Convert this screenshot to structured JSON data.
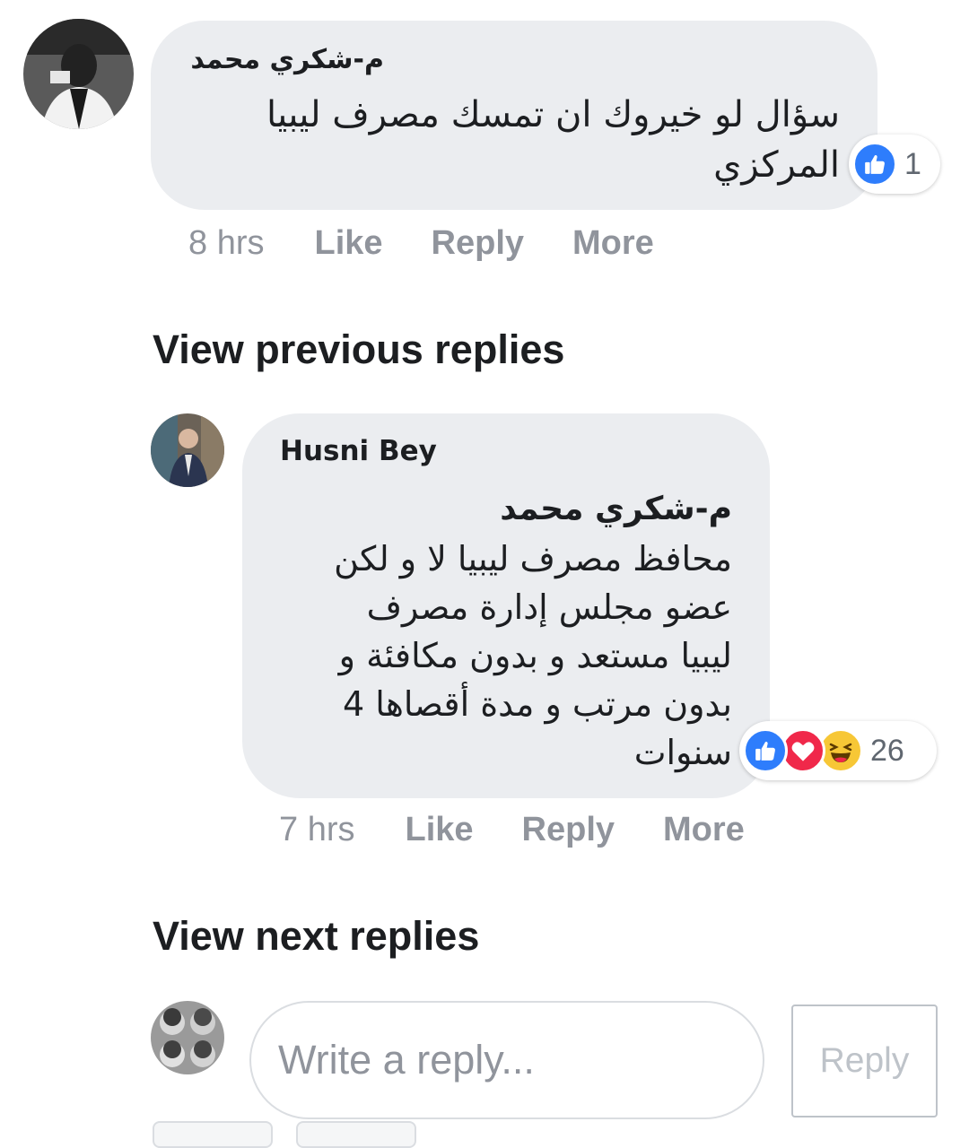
{
  "comment": {
    "author": "م-شكري محمد",
    "lines": [
      "سؤال لو خيروك ان تمسك مصرف ليبيا",
      "المركزي"
    ],
    "reaction_count": "1",
    "time": "8 hrs",
    "actions": {
      "like": "Like",
      "reply": "Reply",
      "more": "More"
    }
  },
  "view_previous": "View previous replies",
  "reply": {
    "author": "Husni Bey",
    "mention": "م-شكري محمد",
    "lines": [
      "محافظ مصرف ليبيا لا و لكن",
      "عضو مجلس إدارة مصرف",
      "ليبيا مستعد و بدون مكافئة و",
      "بدون مرتب و مدة أقصاها 4",
      "سنوات"
    ],
    "reaction_count": "26",
    "time": "7 hrs",
    "actions": {
      "like": "Like",
      "reply": "Reply",
      "more": "More"
    }
  },
  "view_next": "View next replies",
  "composer": {
    "placeholder": "Write a reply...",
    "button": "Reply"
  },
  "icons": {
    "like": "thumbs-up-icon",
    "love": "heart-icon",
    "haha": "laughing-face-icon"
  },
  "colors": {
    "like_blue": "#2e7dfc",
    "love_red": "#f0284a",
    "haha_yellow": "#f7c736",
    "bubble_gray": "#ebedf0",
    "meta_gray": "#90949c"
  }
}
